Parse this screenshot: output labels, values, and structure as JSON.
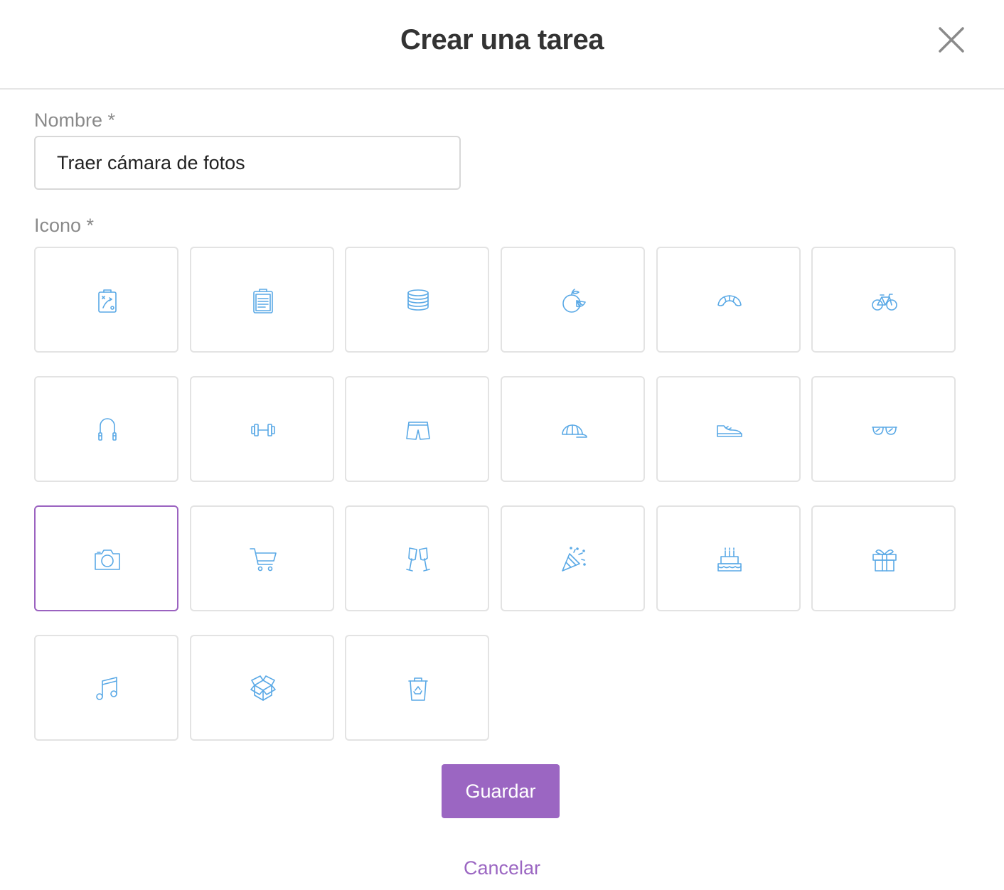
{
  "dialog": {
    "title": "Crear una tarea",
    "close_icon": "close-icon"
  },
  "form": {
    "name_label": "Nombre *",
    "name_value": "Traer cámara de fotos",
    "icon_label": "Icono *"
  },
  "icons": [
    {
      "name": "tactics-clipboard-icon"
    },
    {
      "name": "clipboard-icon"
    },
    {
      "name": "coins-icon"
    },
    {
      "name": "fruit-icon"
    },
    {
      "name": "croissant-icon"
    },
    {
      "name": "bicycle-icon"
    },
    {
      "name": "jump-rope-icon"
    },
    {
      "name": "dumbbell-icon"
    },
    {
      "name": "shorts-icon"
    },
    {
      "name": "cap-icon"
    },
    {
      "name": "sneaker-icon"
    },
    {
      "name": "sunglasses-icon"
    },
    {
      "name": "camera-icon",
      "selected": true
    },
    {
      "name": "shopping-cart-icon"
    },
    {
      "name": "champagne-glasses-icon"
    },
    {
      "name": "party-popper-icon"
    },
    {
      "name": "birthday-cake-icon"
    },
    {
      "name": "gift-icon"
    },
    {
      "name": "music-note-icon"
    },
    {
      "name": "open-box-icon"
    },
    {
      "name": "recycle-bin-icon"
    }
  ],
  "actions": {
    "save_label": "Guardar",
    "cancel_label": "Cancelar"
  },
  "colors": {
    "accent": "#9b66c2",
    "icon_stroke": "#5aa9e6",
    "tile_border": "#e3e3e3"
  }
}
